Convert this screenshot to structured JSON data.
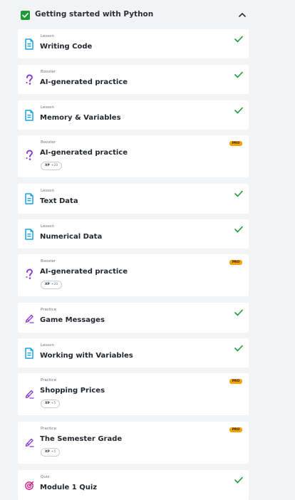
{
  "section": {
    "title": "Getting started with Python",
    "expanded": true
  },
  "colors": {
    "lesson": "#1ba1e2",
    "booster": "#8a35d6",
    "practice": "#8a35d6",
    "quiz": "#d31b8c",
    "check": "#1f9a35",
    "pro": "#f2a20a"
  },
  "items": [
    {
      "kind": "Lesson",
      "title": "Writing Code",
      "icon": "lesson-doc-icon",
      "completed": true
    },
    {
      "kind": "Booster",
      "title": "AI-generated practice",
      "icon": "question-mark-icon",
      "completed": true
    },
    {
      "kind": "Lesson",
      "title": "Memory & Variables",
      "icon": "lesson-doc-icon",
      "completed": true
    },
    {
      "kind": "Booster",
      "title": "AI-generated practice",
      "icon": "question-mark-icon",
      "pro": "PRO",
      "xp_label": "XP",
      "xp_value": "+20"
    },
    {
      "kind": "Lesson",
      "title": "Text Data",
      "icon": "lesson-doc-icon",
      "completed": true
    },
    {
      "kind": "Lesson",
      "title": "Numerical Data",
      "icon": "lesson-doc-icon",
      "completed": true
    },
    {
      "kind": "Booster",
      "title": "AI-generated practice",
      "icon": "question-mark-icon",
      "pro": "PRO",
      "xp_label": "XP",
      "xp_value": "+20"
    },
    {
      "kind": "Practice",
      "title": "Game Messages",
      "icon": "pencil-icon",
      "completed": true
    },
    {
      "kind": "Lesson",
      "title": "Working with Variables",
      "icon": "lesson-doc-icon",
      "completed": true
    },
    {
      "kind": "Practice",
      "title": "Shopping Prices",
      "icon": "pencil-icon",
      "pro": "PRO",
      "xp_label": "XP",
      "xp_value": "+5"
    },
    {
      "kind": "Practice",
      "title": "The Semester Grade",
      "icon": "pencil-icon",
      "pro": "PRO",
      "xp_label": "XP",
      "xp_value": "+5"
    },
    {
      "kind": "Quiz",
      "title": "Module 1 Quiz",
      "icon": "target-icon",
      "completed": true
    }
  ]
}
